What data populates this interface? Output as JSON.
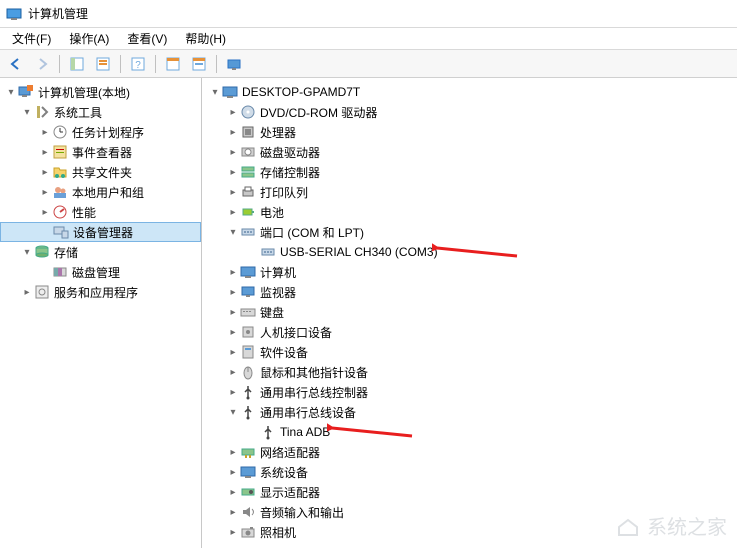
{
  "window": {
    "title": "计算机管理"
  },
  "menu": {
    "file": "文件(F)",
    "actions": "操作(A)",
    "view": "查看(V)",
    "help": "帮助(H)"
  },
  "left_tree": {
    "root": "计算机管理(本地)",
    "system_tools": "系统工具",
    "task_scheduler": "任务计划程序",
    "event_viewer": "事件查看器",
    "shared_folders": "共享文件夹",
    "local_users": "本地用户和组",
    "performance": "性能",
    "device_manager": "设备管理器",
    "storage": "存储",
    "disk_management": "磁盘管理",
    "services_apps": "服务和应用程序"
  },
  "right_tree": {
    "computer": "DESKTOP-GPAMD7T",
    "dvd": "DVD/CD-ROM 驱动器",
    "processors": "处理器",
    "disk_drives": "磁盘驱动器",
    "storage_controllers": "存储控制器",
    "print_queues": "打印队列",
    "batteries": "电池",
    "ports": "端口 (COM 和 LPT)",
    "ports_child": "USB-SERIAL CH340 (COM3)",
    "computers": "计算机",
    "monitors": "监视器",
    "keyboards": "键盘",
    "hid": "人机接口设备",
    "software_devices": "软件设备",
    "mice": "鼠标和其他指针设备",
    "usb_controllers": "通用串行总线控制器",
    "usb_devices": "通用串行总线设备",
    "usb_devices_child": "Tina ADB",
    "network_adapters": "网络适配器",
    "system_devices": "系统设备",
    "display_adapters": "显示适配器",
    "audio": "音频输入和输出",
    "cameras": "照相机"
  },
  "watermark": "系统之家"
}
